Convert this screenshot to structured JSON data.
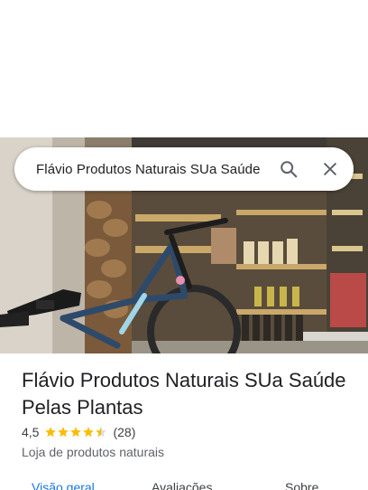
{
  "search": {
    "query": "Flávio Produtos Naturais SUa Saúde",
    "search_icon": "search-icon",
    "close_icon": "close-icon"
  },
  "hero_image": {
    "description_icon": "store-photo"
  },
  "place": {
    "name": "Flávio Produtos Naturais SUa Saúde Pelas Plantas",
    "rating": "4,5",
    "rating_stars": 4.5,
    "review_count": "(28)",
    "category": "Loja de produtos naturais"
  },
  "tabs": [
    {
      "label": "Visão geral",
      "active": true
    },
    {
      "label": "Avaliações",
      "active": false
    },
    {
      "label": "Sobre",
      "active": false
    }
  ],
  "colors": {
    "accent": "#1a73e8",
    "star": "#fbbc04"
  }
}
